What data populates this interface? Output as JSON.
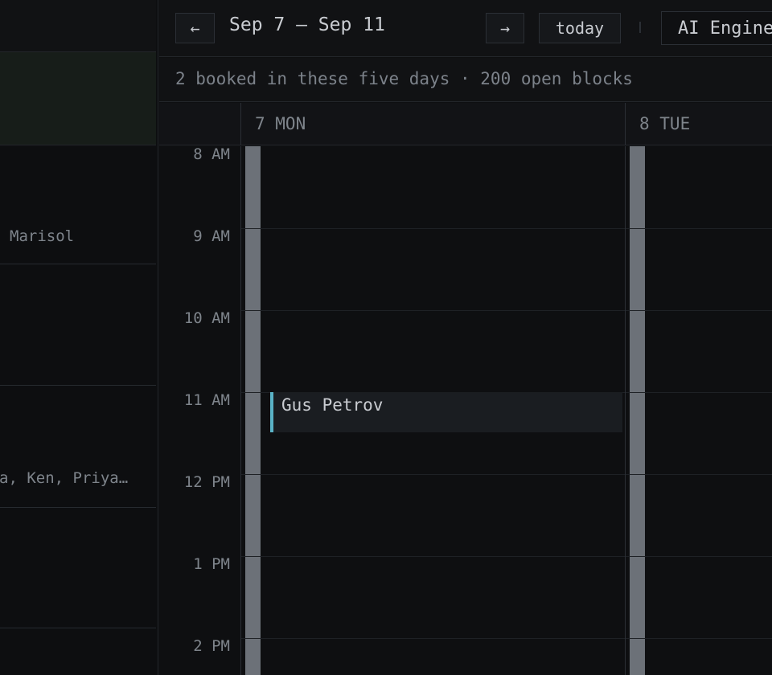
{
  "left_panel": {
    "rows": [
      {
        "text": "Marisol"
      },
      {
        "text": "a, Ken, Priya…"
      }
    ]
  },
  "toolbar": {
    "prev_label": "←",
    "range_label": "Sep 7 – Sep 11",
    "next_label": "→",
    "today_label": "today",
    "team_selected": "AI Engineering"
  },
  "summary": {
    "text": "2 booked in these five days · 200 open blocks"
  },
  "calendar": {
    "days": [
      {
        "label": "7 MON"
      },
      {
        "label": "8 TUE"
      }
    ],
    "hours": [
      "8 AM",
      "9 AM",
      "10 AM",
      "11 AM",
      "12 PM",
      "1 PM",
      "2 PM"
    ],
    "events": [
      {
        "title": "Gus Petrov",
        "day": "7 MON",
        "start": "11 AM"
      }
    ]
  }
}
